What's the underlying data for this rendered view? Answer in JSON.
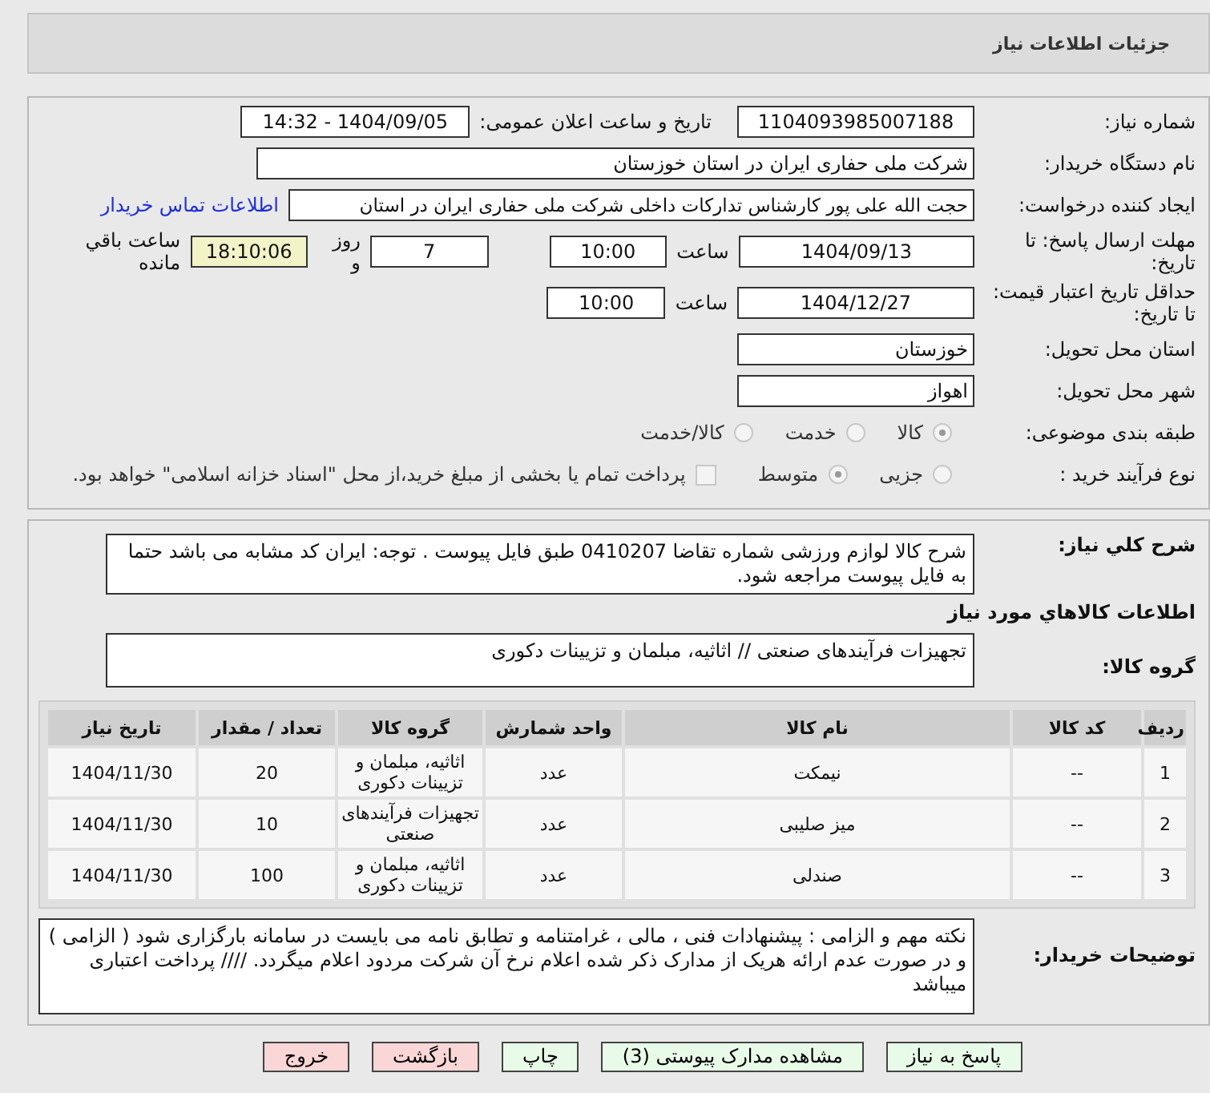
{
  "header": {
    "title": "جزئیات اطلاعات نیاز"
  },
  "need_number": {
    "label": "شماره نیاز:",
    "value": "1104093985007188"
  },
  "announce": {
    "label": "تاریخ و ساعت اعلان عمومی:",
    "value": "1404/09/05 - 14:32"
  },
  "buyer": {
    "label": "نام دستگاه خریدار:",
    "value": "شرکت ملی حفاری ایران در استان خوزستان"
  },
  "requester": {
    "label": "ایجاد کننده درخواست:",
    "value": "حجت الله علی پور کارشناس تدارکات داخلی شرکت ملی حفاری ایران در استان",
    "link": "اطلاعات تماس خریدار"
  },
  "deadline": {
    "label": "مهلت ارسال پاسخ: تا تاریخ:",
    "date": "1404/09/13",
    "time_label": "ساعت",
    "time": "10:00",
    "days": "7",
    "days_label": "روز و",
    "remaining": "18:10:06",
    "remaining_label": "ساعت باقي مانده"
  },
  "validity": {
    "label": "حداقل تاریخ اعتبار قیمت: تا تاریخ:",
    "date": "1404/12/27",
    "time_label": "ساعت",
    "time": "10:00"
  },
  "province": {
    "label": "استان محل تحویل:",
    "value": "خوزستان"
  },
  "city": {
    "label": "شهر محل تحویل:",
    "value": "اهواز"
  },
  "category": {
    "label": "طبقه بندی موضوعی:",
    "options": [
      {
        "label": "کالا",
        "selected": true
      },
      {
        "label": "خدمت",
        "selected": false
      },
      {
        "label": "کالا/خدمت",
        "selected": false
      }
    ]
  },
  "purchase_type": {
    "label": "نوع فرآیند خرید :",
    "options": [
      {
        "label": "جزیی",
        "selected": false
      },
      {
        "label": "متوسط",
        "selected": true
      }
    ],
    "treasury": {
      "checked": false,
      "text": "پرداخت تمام یا بخشی از مبلغ خرید،از محل \"اسناد خزانه اسلامی\" خواهد بود."
    }
  },
  "description": {
    "label": "شرح کلي نياز:",
    "value": "شرح کالا لوازم ورزشی  شماره تقاضا  0410207  طبق فایل پیوست . توجه: ایران کد مشابه می باشد حتما به فایل پیوست مراجعه شود."
  },
  "items_title": "اطلاعات کالاهاي مورد نياز",
  "goods_group": {
    "label": "گروه کالا:",
    "value": "تجهیزات فرآیندهای صنعتی // اثاثیه، مبلمان و تزیینات دکوری"
  },
  "table": {
    "columns": [
      "ردیف",
      "کد کالا",
      "نام کالا",
      "واحد شمارش",
      "گروه کالا",
      "تعداد / مقدار",
      "تاریخ نیاز"
    ],
    "rows": [
      [
        "1",
        "--",
        "نیمکت",
        "عدد",
        "اثاثیه، مبلمان و تزیینات دکوری",
        "20",
        "1404/11/30"
      ],
      [
        "2",
        "--",
        "میز صلیبی",
        "عدد",
        "تجهیزات فرآیندهای صنعتی",
        "10",
        "1404/11/30"
      ],
      [
        "3",
        "--",
        "صندلی",
        "عدد",
        "اثاثیه، مبلمان و تزیینات دکوری",
        "100",
        "1404/11/30"
      ]
    ]
  },
  "buyer_notes": {
    "label": "توضیحات خریدار:",
    "value": "نکته مهم و الزامی : پیشنهادات فنی ، مالی ، غرامتنامه و تطابق نامه می بایست در سامانه بارگزاری شود ( الزامی ) و در صورت عدم ارائه هریک از مدارک ذکر شده اعلام نرخ آن شرکت مردود اعلام میگردد.  //// پرداخت اعتباری میباشد"
  },
  "buttons": [
    {
      "label": "پاسخ به نیاز",
      "kind": "normal"
    },
    {
      "label": "مشاهده مدارک پیوستی (3)",
      "kind": "normal"
    },
    {
      "label": "چاپ",
      "kind": "normal"
    },
    {
      "label": "بازگشت",
      "kind": "danger"
    },
    {
      "label": "خروج",
      "kind": "danger"
    }
  ]
}
